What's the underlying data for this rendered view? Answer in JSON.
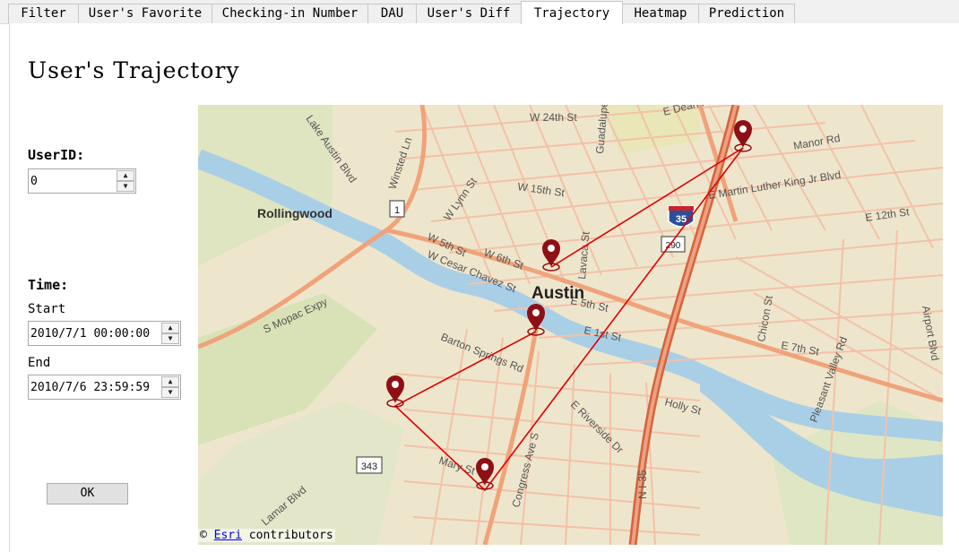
{
  "tabs": [
    {
      "label": "Filter"
    },
    {
      "label": "User's Favorite"
    },
    {
      "label": "Checking-in Number"
    },
    {
      "label": "DAU"
    },
    {
      "label": "User's Diff"
    },
    {
      "label": "Trajectory"
    },
    {
      "label": "Heatmap"
    },
    {
      "label": "Prediction"
    }
  ],
  "active_tab": "Trajectory",
  "page": {
    "title": "User's Trajectory"
  },
  "form": {
    "userid_label": "UserID:",
    "userid_value": "0",
    "time_label": "Time:",
    "start_label": "Start",
    "start_value": "2010/7/1 00:00:00",
    "end_label": "End",
    "end_value": "2010/7/6 23:59:59",
    "ok_label": "OK"
  },
  "map": {
    "attribution_prefix": "©",
    "attribution_link": "Esri",
    "attribution_suffix": "contributors",
    "labels": {
      "city": "Austin",
      "rollingwood": "Rollingwood",
      "w24": "W 24th St",
      "dean_keeton": "E Dean Keeton St",
      "manor": "Manor Rd",
      "mlk": "E Martin Luther King Jr Blvd",
      "w15": "W 15th St",
      "e12": "E 12th St",
      "lynn": "W Lynn St",
      "w5": "W 5th St",
      "w6": "W 6th St",
      "winsted": "Winsted Ln",
      "lake_austin": "Lake Austin Blvd",
      "cesar_chavez": "W Cesar Chavez St",
      "mopac": "S Mopac Expy",
      "barton": "Barton Springs Rd",
      "e1": "E 1st St",
      "e5": "E 5th St",
      "e7": "E 7th St",
      "holly": "Holly St",
      "riverside": "E Riverside Dr",
      "congress": "Congress Ave S",
      "lamar": "Lamar Blvd",
      "mary": "Mary St",
      "chicon": "Chicon St",
      "pleasant_valley": "Pleasant Valley Rd",
      "airport": "Airport Blvd",
      "guadalupe": "Guadalupe St",
      "lavaca": "Lavaca St",
      "ih35": "N I-35",
      "shield_1": "1",
      "shield_35": "35",
      "shield_290": "290",
      "shield_343": "343"
    },
    "route_color": "#e00000",
    "pin_color": "#8e1015"
  }
}
